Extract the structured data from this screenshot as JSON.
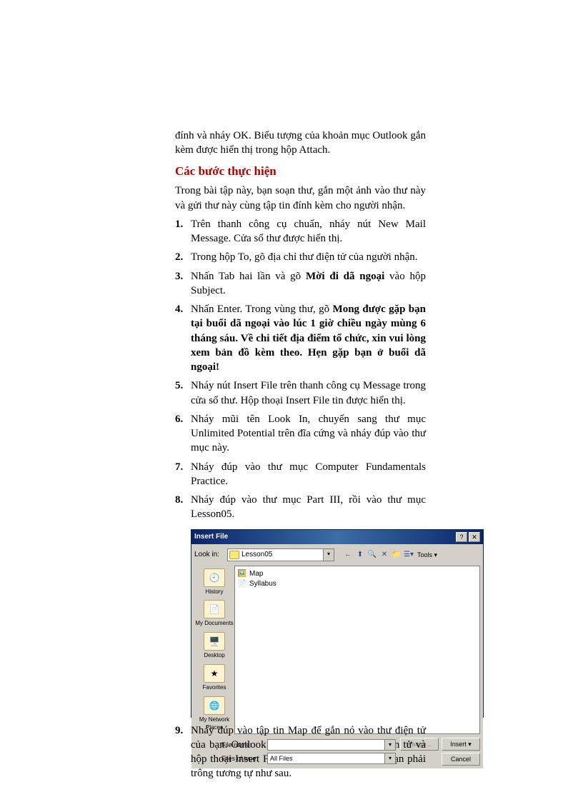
{
  "intro": "đính và nháy OK. Biểu tượng của khoản mục Outlook gắn kèm được hiển thị trong hộp Attach.",
  "heading": "Các bước thực hiện",
  "para2": "Trong bài tập này, bạn soạn thư, gắn một ảnh vào thư này và gửi thư này cùng tập tin đính kèm cho người nhận.",
  "steps": {
    "s1": "Trên thanh công cụ chuẩn, nháy nút New Mail Message. Cửa sổ thư được hiển thị.",
    "s2": "Trong hộp To, gõ địa chỉ thư điện tử của người nhận.",
    "s3a": "Nhấn Tab hai lần và gõ ",
    "s3b": "Mời đi dã ngoại",
    "s3c": " vào hộp Subject.",
    "s4a": "Nhấn Enter. Trong vùng thư, gõ ",
    "s4b": "Mong được gặp bạn tại buổi dã ngoại vào lúc 1 giờ chiều ngày mùng 6 tháng sáu. Về chi tiết địa điểm tổ chức, xin vui lòng xem bản đồ kèm theo. Hẹn gặp bạn ở buổi dã ngoại!",
    "s5": "Nháy nút Insert File trên thanh công cụ Message trong cửa sổ thư. Hộp thoại Insert File tin được hiển thị.",
    "s6": "Nháy mũi tên Look In, chuyển sang thư mục Unlimited Potential trên đĩa cứng và nháy đúp vào thư mục này.",
    "s7": "Nháy đúp vào thư mục Computer Fundamentals Practice.",
    "s8": "Nháy đúp vào thư mục Part III, rồi vào thư mục Lesson05.",
    "s9": "Nháy đúp vào tập tin Map để gắn nó vào thư điện tử của bạn. Outlook gắn tập tin Map vào thư điện tử và hộp thoại Insert File đóng lại. Màn hình của bạn phải trông tương tự như sau."
  },
  "dialog": {
    "title": "Insert File",
    "help": "?",
    "close": "✕",
    "lookin_label": "Look in:",
    "lookin_value": "Lesson05",
    "tools_label": "Tools ▾",
    "sidebar": {
      "history": "History",
      "mydocs": "My Documents",
      "desktop": "Desktop",
      "favorites": "Favorites",
      "network": "My Network Places"
    },
    "files": {
      "map": "Map",
      "syllabus": "Syllabus"
    },
    "filename_label": "File name:",
    "filetype_label": "Files of type:",
    "filetype_value": "All Files",
    "range_btn": "Range...",
    "insert_btn": "Insert ▾",
    "cancel_btn": "Cancel"
  }
}
